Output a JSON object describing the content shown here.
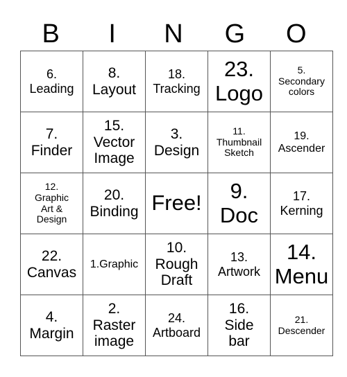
{
  "header": [
    "B",
    "I",
    "N",
    "G",
    "O"
  ],
  "rows": [
    [
      {
        "lines": [
          "6.",
          "Leading"
        ],
        "size": "s3"
      },
      {
        "lines": [
          "8.",
          "Layout"
        ],
        "size": "s2"
      },
      {
        "lines": [
          "18.",
          "Tracking"
        ],
        "size": "s3"
      },
      {
        "lines": [
          "23.",
          "Logo"
        ],
        "size": "s1"
      },
      {
        "lines": [
          "5.",
          "Secondary",
          "colors"
        ],
        "size": "s5"
      }
    ],
    [
      {
        "lines": [
          "7.",
          "Finder"
        ],
        "size": "s2"
      },
      {
        "lines": [
          "15.",
          "Vector",
          "Image"
        ],
        "size": "s2"
      },
      {
        "lines": [
          "3.",
          "Design"
        ],
        "size": "s2"
      },
      {
        "lines": [
          "11.",
          "Thumbnail",
          "Sketch"
        ],
        "size": "s5"
      },
      {
        "lines": [
          "19.",
          "Ascender"
        ],
        "size": "s4"
      }
    ],
    [
      {
        "lines": [
          "12.",
          "Graphic",
          "Art &",
          "Design"
        ],
        "size": "s5"
      },
      {
        "lines": [
          "20.",
          "Binding"
        ],
        "size": "s2"
      },
      {
        "lines": [
          "Free!"
        ],
        "size": "s1"
      },
      {
        "lines": [
          "9.",
          "Doc"
        ],
        "size": "s1"
      },
      {
        "lines": [
          "17.",
          "Kerning"
        ],
        "size": "s3"
      }
    ],
    [
      {
        "lines": [
          "22.",
          "Canvas"
        ],
        "size": "s2"
      },
      {
        "lines": [
          "1.Graphic"
        ],
        "size": "s4"
      },
      {
        "lines": [
          "10.",
          "Rough",
          "Draft"
        ],
        "size": "s2"
      },
      {
        "lines": [
          "13.",
          "Artwork"
        ],
        "size": "s3"
      },
      {
        "lines": [
          "14.",
          "Menu"
        ],
        "size": "s1"
      }
    ],
    [
      {
        "lines": [
          "4.",
          "Margin"
        ],
        "size": "s2"
      },
      {
        "lines": [
          "2.",
          "Raster",
          "image"
        ],
        "size": "s2"
      },
      {
        "lines": [
          "24.",
          "Artboard"
        ],
        "size": "s3"
      },
      {
        "lines": [
          "16.",
          "Side",
          "bar"
        ],
        "size": "s2"
      },
      {
        "lines": [
          "21.",
          "Descender"
        ],
        "size": "s5"
      }
    ]
  ]
}
